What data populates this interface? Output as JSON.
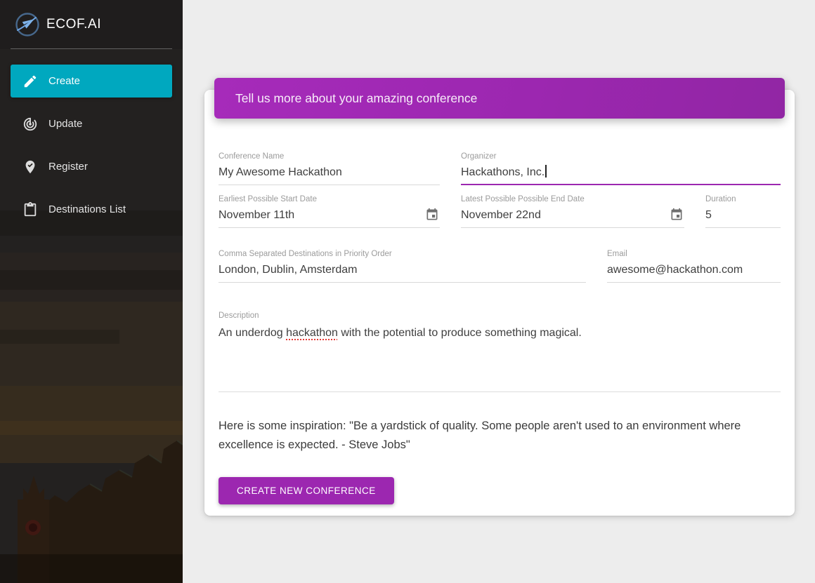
{
  "colors": {
    "sidebar_active_teal": "#00A8BF",
    "banner_purple": "#9C27B0",
    "button_purple": "#9C27B0",
    "focus_underline_purple": "#9C27B0",
    "spellcheck_red": "#E53935",
    "page_background": "#EDEDED"
  },
  "sidebar": {
    "logo_text": "ECOF.AI",
    "logo_icon": "plane-circle-logo-icon",
    "items": [
      {
        "label": "Create",
        "icon": "pencil-icon",
        "active": true
      },
      {
        "label": "Update",
        "icon": "track-changes-icon",
        "active": false
      },
      {
        "label": "Register",
        "icon": "pin-check-icon",
        "active": false
      },
      {
        "label": "Destinations List",
        "icon": "clipboard-icon",
        "active": false
      }
    ]
  },
  "banner": {
    "title": "Tell us more about your amazing conference"
  },
  "form": {
    "conference_name": {
      "label": "Conference Name",
      "value": "My Awesome Hackathon"
    },
    "organizer": {
      "label": "Organizer",
      "value": "Hackathons, Inc.",
      "focused": true
    },
    "start_date": {
      "label": "Earliest Possible Start Date",
      "value": "November 11th",
      "icon": "calendar-icon"
    },
    "end_date": {
      "label": "Latest Possible Possible End Date",
      "value": "November 22nd",
      "icon": "calendar-icon"
    },
    "duration": {
      "label": "Duration",
      "value": "5"
    },
    "destinations": {
      "label": "Comma Separated Destinations in Priority Order",
      "value": "London, Dublin, Amsterdam"
    },
    "email": {
      "label": "Email",
      "value": "awesome@hackathon.com"
    },
    "description": {
      "label": "Description",
      "value_before": "An underdog ",
      "misspelled_word": "hackathon",
      "value_after": " with the potential to produce something magical."
    }
  },
  "inspiration": "Here is some inspiration: \"Be a yardstick of quality. Some people aren't used to an environment where excellence is expected. - Steve Jobs\"",
  "submit": {
    "label": "CREATE NEW CONFERENCE"
  }
}
